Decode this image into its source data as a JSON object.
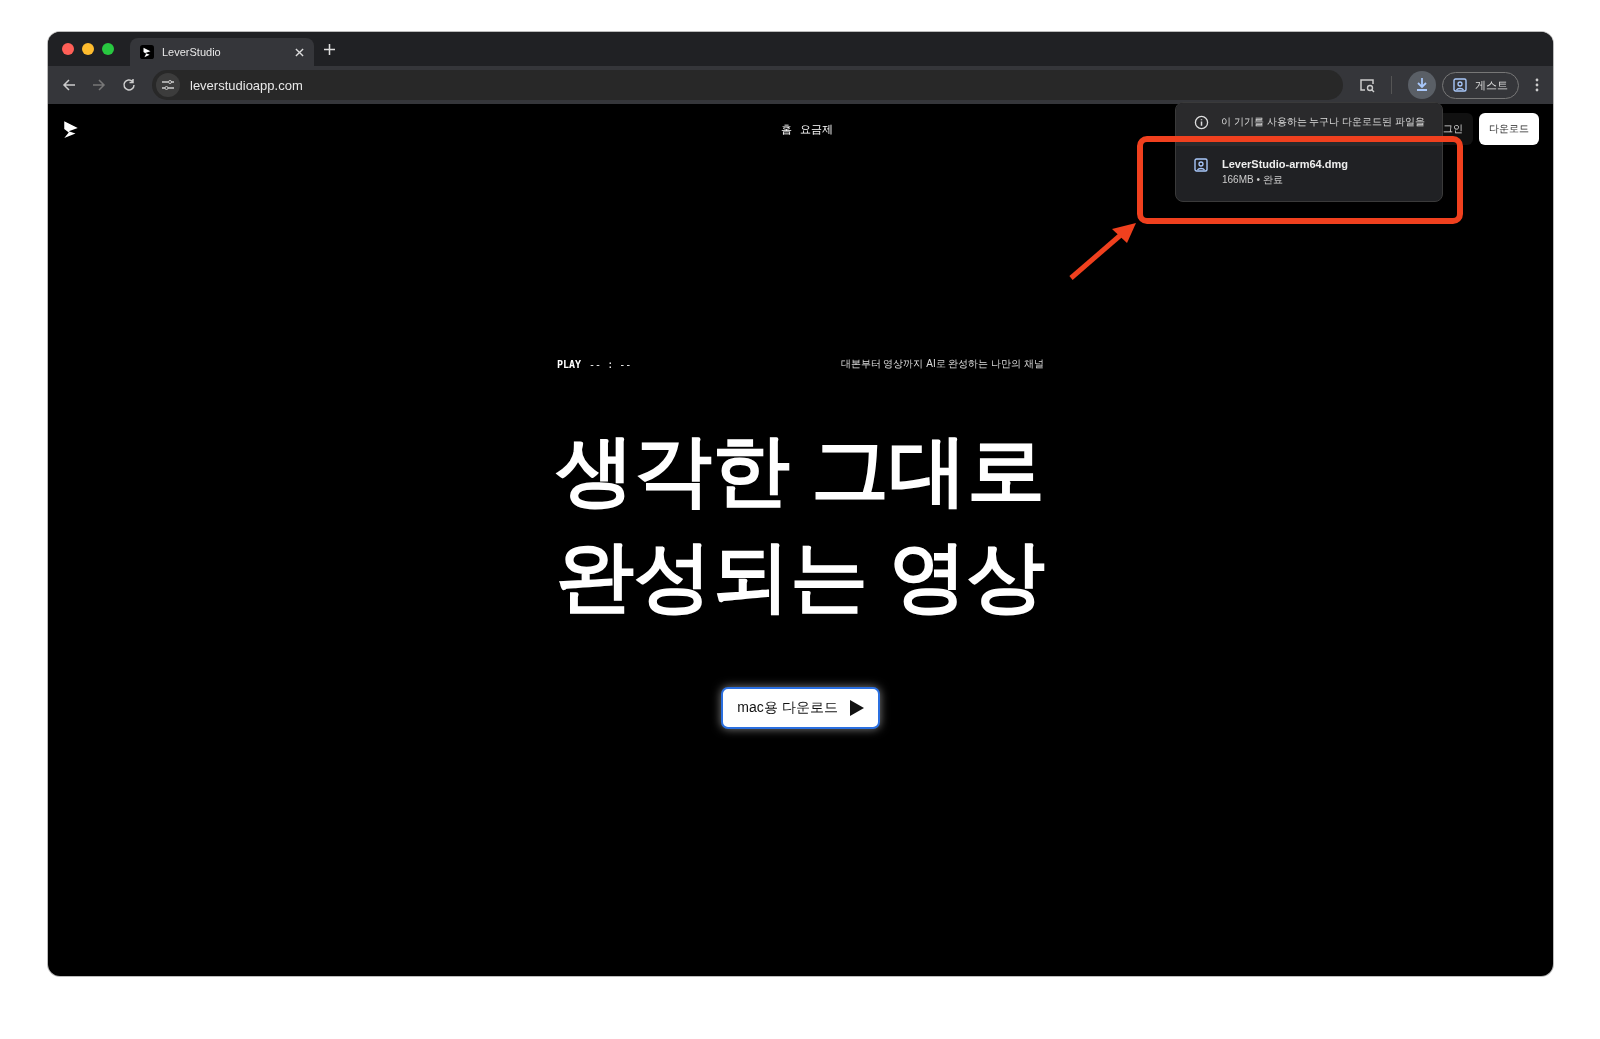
{
  "browser": {
    "tab": {
      "title": "LeverStudio"
    },
    "url": "leverstudioapp.com",
    "profile": "게스트"
  },
  "nav": {
    "links": [
      "홈",
      "요금제"
    ],
    "login": "그인",
    "download": "다운로드"
  },
  "downloads_popup": {
    "notice": "이 기기를 사용하는 누구나 다운로드된 파일을",
    "items": [
      {
        "file": "LeverStudio-arm64.dmg",
        "meta": "166MB • 완료"
      }
    ]
  },
  "hero": {
    "play": "PLAY",
    "time": "-- : --",
    "tagline": "대본부터 영상까지 AI로 완성하는 나만의 채널",
    "headline": [
      "생각한 그대로",
      "완성되는 영상"
    ],
    "cta": "mac용 다운로드"
  },
  "annotation": {
    "kind": "highlight"
  }
}
